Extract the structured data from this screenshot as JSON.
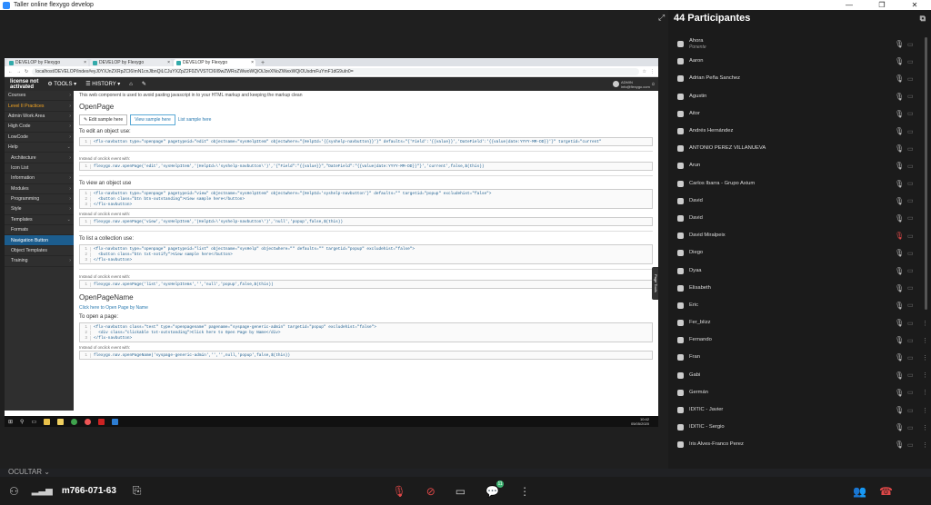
{
  "window": {
    "title": "Taller online flexygo develop"
  },
  "browser": {
    "tabs": [
      {
        "label": "DEVELOP by Flexygo"
      },
      {
        "label": "DEVELOP by Flexygo"
      },
      {
        "label": "DEVELOP by Flexygo"
      }
    ],
    "url": "localhost/DEVELOP/index#eyJ0YXJnZXRpZCI6ImN1cnJlbnQiLCJuYXZpZ2F0ZVVSTCI6Il9wZWRoZWwoWQiOiJzeXNoZWwxWQiOUsdmFuYmF1dG9uIn0="
  },
  "app": {
    "brand_line1": "license not",
    "brand_line2": "activated",
    "tools_label": "TOOLS",
    "history_label": "HISTORY",
    "user_line1": "ADMIN",
    "user_line2": "info@flexygo.com"
  },
  "sidebar": {
    "items": [
      {
        "label": "Courses"
      },
      {
        "label": "Level II Practices"
      },
      {
        "label": "Admin Work Area"
      },
      {
        "label": "High Code"
      },
      {
        "label": "LowCode"
      },
      {
        "label": "Help"
      },
      {
        "label": "Architecture"
      },
      {
        "label": "Icon List"
      },
      {
        "label": "Information"
      },
      {
        "label": "Modules"
      },
      {
        "label": "Programming"
      },
      {
        "label": "Style"
      },
      {
        "label": "Templates"
      },
      {
        "label": "Formats"
      },
      {
        "label": "Navigation Button"
      },
      {
        "label": "Object Templates"
      },
      {
        "label": "Training"
      }
    ]
  },
  "content": {
    "intro": "This web component is used to avoid pasting javascript in to your HTML markup and keeping the markup clean",
    "openpage_title": "OpenPage",
    "btn_edit": "Edit sample here",
    "btn_view": "View sample here",
    "btn_list": "List sample here",
    "edit_heading": "To edit an object use:",
    "edit_code": "<flx-navbutton type=\"openpage\" pagetypeid=\"edit\" objectname=\"sysHelpItem\" objectwhere=\"{HelpId='{{syshelp-navbutton}}'}\" defaults=\"{'Field':'{{value}}','DateField':'{{value|date:YYYY-MM-DD}}'}\" targetid=\"current\"",
    "instead_note": "Instead of onclick event with:",
    "edit_js": "flexygo.nav.openPage('edit','sysHelpItem','(HelpId=\\'syshelp-navbutton\\')','{\"Field\":\"{{value}}\",\"DateField\":\"{{value|date:YYYY-MM-DD}}\"}','current',false,$(this))",
    "view_heading": "To view an object use",
    "view_code_1": "<flx-navbutton type=\"openpage\" pagetypeid=\"view\" objectname=\"sysHelpItem\" objectwhere=\"{HelpId='syshelp-navbutton'}\" defaults=\"\" targetid=\"popup\" excludehist=\"false\">",
    "view_code_2": "  <button class=\"btn btn-outstanding\">View sample here</button>",
    "view_code_3": "</flx-navbutton>",
    "view_js": "flexygo.nav.openPage('view','sysHelpItem','(HelpId=\\'syshelp-navbutton\\')','null','popup',false,$(this))",
    "list_heading": "To list a collection use:",
    "list_code_1": "<flx-navbutton type=\"openpage\" pagetypeid=\"list\" objectname=\"sysHelp\" objectwhere=\"\" defaults=\"\" targetid=\"popup\" excludehist=\"false\">",
    "list_code_2": "  <button class=\"btn txt-notify\">View sample here</button>",
    "list_code_3": "</flx-navbutton>",
    "list_js": "flexygo.nav.openPage('list','sysHelpItems','','null','popup',false,$(this))",
    "opn_title": "OpenPageName",
    "opn_link": "Click here to Open Page by Name",
    "open_heading": "To open a page:",
    "open_code_1": "<flx-navbutton class=\"test\" type=\"openpagename\" pagename=\"syspage-generic-admin\" targetid=\"popup\" excludehist=\"false\">",
    "open_code_2": "  <div class=\"clickable txt-outstanding\">Click here to Open Page by Name</div>",
    "open_code_3": "</flx-navbutton>",
    "open_js": "flexygo.nav.openPageName('syspage-generic-admin','','',null,'popup',false,$(this))",
    "page_tools": "Page Tools"
  },
  "taskbar": {
    "time": "10:42",
    "date": "05/05/2020"
  },
  "participants": {
    "title": "44 Participantes",
    "list": [
      {
        "name": "Ahora",
        "role": "Ponente",
        "mic": "on"
      },
      {
        "name": "Aaron",
        "mic": "on"
      },
      {
        "name": "Adrian Peña Sanchez",
        "mic": "on"
      },
      {
        "name": "Agustin",
        "mic": "on"
      },
      {
        "name": "Aitor",
        "mic": "on"
      },
      {
        "name": "Andrés Hernández",
        "mic": "on"
      },
      {
        "name": "ANTONIO PEREZ VILLANUEVA",
        "mic": "on"
      },
      {
        "name": "Arun",
        "mic": "on"
      },
      {
        "name": "Carlos Ibarra - Grupo Axium",
        "mic": "on"
      },
      {
        "name": "David",
        "mic": "on"
      },
      {
        "name": "David",
        "mic": "on"
      },
      {
        "name": "David Miralpeix",
        "mic": "off"
      },
      {
        "name": "Diego",
        "mic": "on"
      },
      {
        "name": "Dyaa",
        "mic": "on"
      },
      {
        "name": "Elisabeth",
        "mic": "on"
      },
      {
        "name": "Eric",
        "mic": "on"
      },
      {
        "name": "Fer_blizz",
        "mic": "on"
      },
      {
        "name": "Fernando",
        "mic": "on"
      },
      {
        "name": "Fran",
        "mic": "on"
      },
      {
        "name": "Gabi",
        "mic": "on"
      },
      {
        "name": "Germán",
        "mic": "on"
      },
      {
        "name": "IDITIC - Javier",
        "mic": "on"
      },
      {
        "name": "IDITIC - Sergio",
        "mic": "on"
      },
      {
        "name": "Iris Alves-Franco Perez",
        "mic": "on"
      }
    ]
  },
  "bottombar": {
    "hide_label": "OCULTAR",
    "meeting_id": "m766-071-63",
    "chat_count": "11"
  }
}
